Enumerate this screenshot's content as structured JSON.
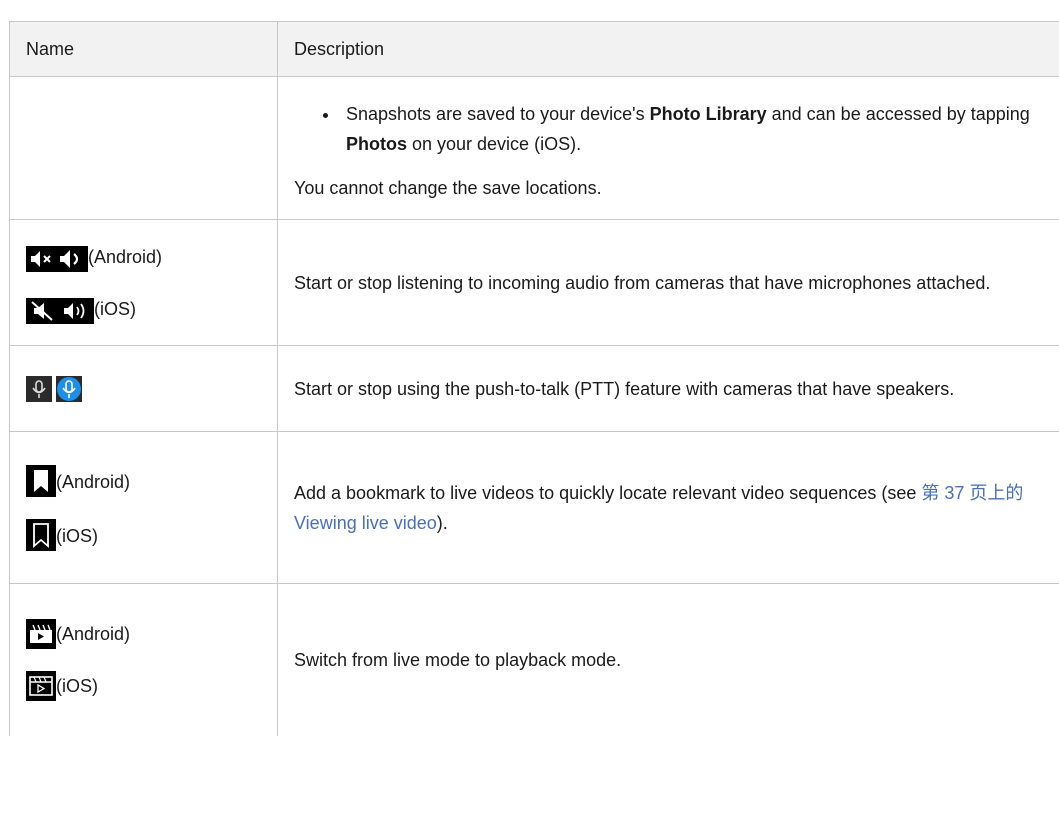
{
  "header": {
    "name": "Name",
    "description": "Description"
  },
  "rows": [
    {
      "bullet_prefix": "Snapshots are saved to your device's ",
      "bullet_bold1": "Photo Library",
      "bullet_mid": " and can be accessed by tapping ",
      "bullet_bold2": "Photos",
      "bullet_suffix": " on your device (iOS).",
      "note": "You cannot change the save locations."
    },
    {
      "android_label": "(Android)",
      "ios_label": "(iOS)",
      "description": "Start or stop listening to incoming audio from cameras that have microphones attached."
    },
    {
      "description": "Start or stop using the push-to-talk (PTT) feature with cameras that have speakers."
    },
    {
      "android_label": "(Android)",
      "ios_label": "(iOS)",
      "desc_prefix": "Add a bookmark to live videos to quickly locate relevant video sequences (see ",
      "link_text": "第 37 页上的Viewing live video",
      "desc_suffix": ")."
    },
    {
      "android_label": "(Android)",
      "ios_label": "(iOS)",
      "description": "Switch from live mode to playback mode."
    }
  ],
  "icons": {
    "audio_android": "speaker-mute-icon / speaker-on-icon",
    "audio_ios": "speaker-slash-icon / speaker-waves-icon",
    "ptt": "microphone-off-icon / microphone-on-icon",
    "bookmark": "bookmark-icon",
    "playback": "clapperboard-play-icon"
  },
  "colors": {
    "link": "#4a6fb5",
    "border": "#c8c8c8",
    "header_bg": "#f2f2f2",
    "mic_active": "#1e8fe6"
  }
}
